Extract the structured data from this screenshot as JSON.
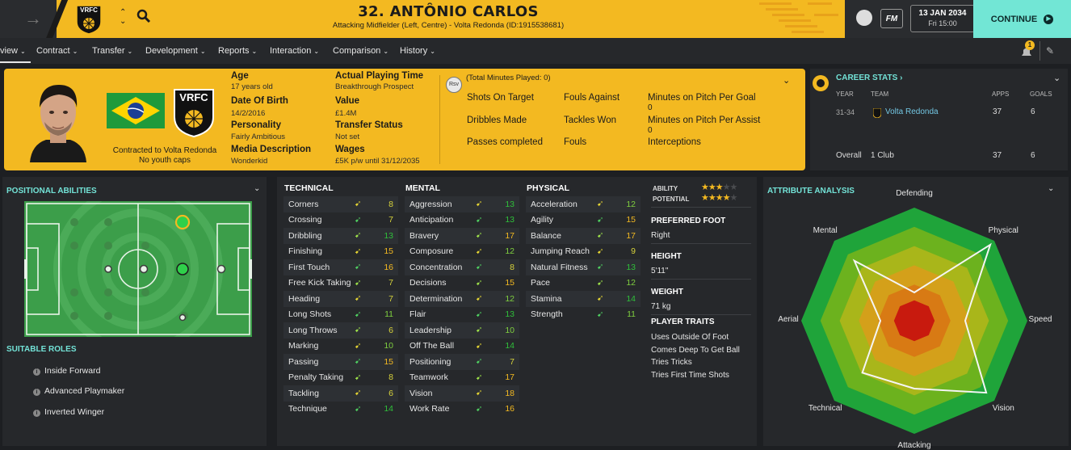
{
  "header": {
    "player_title": "32. ANTÔNIO CARLOS",
    "player_subtitle": "Attacking Midfielder (Left, Centre) - Volta Redonda (ID:1915538681)",
    "club_badge": "VRFC",
    "date": "13 JAN 2034",
    "time": "Fri 15:00",
    "fm_label": "FM",
    "continue_label": "CONTINUE"
  },
  "nav": {
    "items": [
      "view",
      "Contract",
      "Transfer",
      "Development",
      "Reports",
      "Interaction",
      "Comparison",
      "History"
    ],
    "notification_count": "1"
  },
  "card": {
    "contract_line": "Contracted to Volta Redonda",
    "youth_line": "No youth caps",
    "badge": "VRFC",
    "age_label": "Age",
    "age_value": "17 years old",
    "dob_label": "Date Of Birth",
    "dob_value": "14/2/2016",
    "personality_label": "Personality",
    "personality_value": "Fairly Ambitious",
    "media_label": "Media Description",
    "media_value": "Wonderkid",
    "apt_label": "Actual Playing Time",
    "apt_value": "Breakthrough Prospect",
    "value_label": "Value",
    "value_value": "£1.4M",
    "transfer_label": "Transfer Status",
    "transfer_value": "Not set",
    "wages_label": "Wages",
    "wages_value": "£5K p/w until 31/12/2035",
    "rsv": "Rsv",
    "minutes_played": "(Total Minutes Played: 0)",
    "stats": {
      "shots_on_target": "Shots On Target",
      "dribbles_made": "Dribbles Made",
      "passes_completed": "Passes completed",
      "fouls_against": "Fouls Against",
      "tackles_won": "Tackles Won",
      "fouls": "Fouls",
      "mins_per_goal": "Minutes on Pitch Per Goal",
      "mins_per_goal_value": "0",
      "mins_per_assist": "Minutes on Pitch Per Assist",
      "mins_per_assist_value": "0",
      "interceptions": "Interceptions"
    }
  },
  "career": {
    "title": "CAREER STATS",
    "headers": {
      "year": "YEAR",
      "team": "TEAM",
      "apps": "APPS",
      "goals": "GOALS"
    },
    "rows": [
      {
        "year": "31-34",
        "team": "Volta Redonda",
        "apps": "37",
        "goals": "6"
      }
    ],
    "overall": {
      "label": "Overall",
      "team": "1 Club",
      "apps": "37",
      "goals": "6"
    }
  },
  "positional": {
    "title": "POSITIONAL ABILITIES",
    "roles_title": "SUITABLE ROLES",
    "roles": [
      "Inside Forward",
      "Advanced Playmaker",
      "Inverted Winger"
    ]
  },
  "attributes": {
    "technical_title": "TECHNICAL",
    "mental_title": "MENTAL",
    "physical_title": "PHYSICAL",
    "technical": [
      {
        "name": "Corners",
        "value": "8"
      },
      {
        "name": "Crossing",
        "value": "7"
      },
      {
        "name": "Dribbling",
        "value": "13"
      },
      {
        "name": "Finishing",
        "value": "15"
      },
      {
        "name": "First Touch",
        "value": "16"
      },
      {
        "name": "Free Kick Taking",
        "value": "7"
      },
      {
        "name": "Heading",
        "value": "7"
      },
      {
        "name": "Long Shots",
        "value": "11"
      },
      {
        "name": "Long Throws",
        "value": "6"
      },
      {
        "name": "Marking",
        "value": "10"
      },
      {
        "name": "Passing",
        "value": "15"
      },
      {
        "name": "Penalty Taking",
        "value": "8"
      },
      {
        "name": "Tackling",
        "value": "6"
      },
      {
        "name": "Technique",
        "value": "14"
      }
    ],
    "mental": [
      {
        "name": "Aggression",
        "value": "13"
      },
      {
        "name": "Anticipation",
        "value": "13"
      },
      {
        "name": "Bravery",
        "value": "17"
      },
      {
        "name": "Composure",
        "value": "12"
      },
      {
        "name": "Concentration",
        "value": "8"
      },
      {
        "name": "Decisions",
        "value": "15"
      },
      {
        "name": "Determination",
        "value": "12"
      },
      {
        "name": "Flair",
        "value": "13"
      },
      {
        "name": "Leadership",
        "value": "10"
      },
      {
        "name": "Off The Ball",
        "value": "14"
      },
      {
        "name": "Positioning",
        "value": "7"
      },
      {
        "name": "Teamwork",
        "value": "17"
      },
      {
        "name": "Vision",
        "value": "18"
      },
      {
        "name": "Work Rate",
        "value": "16"
      }
    ],
    "physical": [
      {
        "name": "Acceleration",
        "value": "12"
      },
      {
        "name": "Agility",
        "value": "15"
      },
      {
        "name": "Balance",
        "value": "17"
      },
      {
        "name": "Jumping Reach",
        "value": "9"
      },
      {
        "name": "Natural Fitness",
        "value": "13"
      },
      {
        "name": "Pace",
        "value": "12"
      },
      {
        "name": "Stamina",
        "value": "14"
      },
      {
        "name": "Strength",
        "value": "11"
      }
    ]
  },
  "info": {
    "ability_label": "ABILITY",
    "ability_stars": 3,
    "potential_label": "POTENTIAL",
    "potential_stars": 4,
    "stars_total": 5,
    "foot_label": "PREFERRED FOOT",
    "foot_value": "Right",
    "height_label": "HEIGHT",
    "height_value": "5'11\"",
    "weight_label": "WEIGHT",
    "weight_value": "71 kg",
    "traits_label": "PLAYER TRAITS",
    "traits": [
      "Uses Outside Of Foot",
      "Comes Deep To Get Ball",
      "Tries Tricks",
      "Tries First Time Shots"
    ]
  },
  "analysis": {
    "title": "ATTRIBUTE ANALYSIS",
    "axes": [
      "Defending",
      "Physical",
      "Speed",
      "Vision",
      "Attacking",
      "Technical",
      "Aerial",
      "Mental"
    ],
    "levels": [
      0.25,
      0.95,
      0.45,
      0.9,
      0.6,
      0.65,
      0.3,
      0.75
    ]
  },
  "colors": {
    "accent": "#f3b921",
    "teal": "#73e3d7",
    "high": "#f3b921",
    "mid": "#2fbf3a",
    "low": "#8fd14f"
  }
}
